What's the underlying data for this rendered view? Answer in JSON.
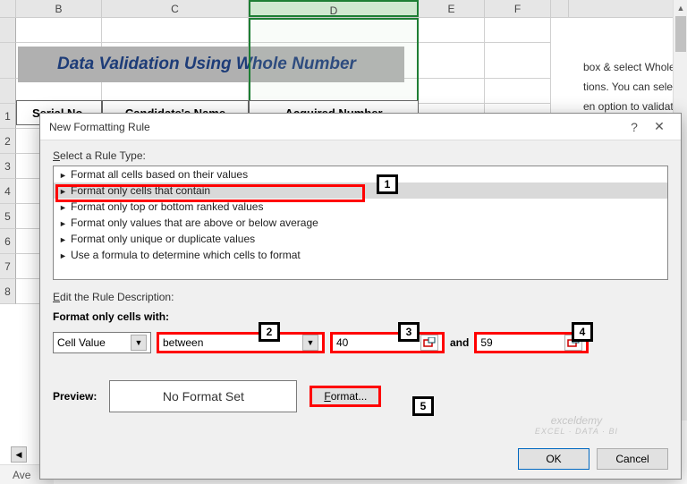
{
  "columns": [
    "",
    "B",
    "C",
    "D",
    "E",
    "F",
    ""
  ],
  "rows": [
    "",
    "",
    "",
    "1",
    "2",
    "3",
    "4",
    "5",
    "6",
    "7",
    "8"
  ],
  "banner_title": "Data Validation Using Whole Number",
  "table_headers": [
    "Serial No.",
    "Candidate's Name",
    "Acquired Number"
  ],
  "side_text": [
    "box & select Whole",
    "tions. You can selec",
    "en option to validate"
  ],
  "status_text": "Ave",
  "dialog": {
    "title": "New Formatting Rule",
    "help": "?",
    "close": "✕",
    "select_label": "Select a Rule Type:",
    "rule_types": [
      "Format all cells based on their values",
      "Format only cells that contain",
      "Format only top or bottom ranked values",
      "Format only values that are above or below average",
      "Format only unique or duplicate values",
      "Use a formula to determine which cells to format"
    ],
    "selected_type_index": 1,
    "edit_label": "Edit the Rule Description:",
    "format_only_label": "Format only cells with:",
    "cell_value": "Cell Value",
    "operator": "between",
    "val1": "40",
    "and": "and",
    "val2": "59",
    "preview_label": "Preview:",
    "preview_text": "No Format Set",
    "format_btn": "Format...",
    "ok": "OK",
    "cancel": "Cancel"
  },
  "callouts": {
    "1": "1",
    "2": "2",
    "3": "3",
    "4": "4",
    "5": "5"
  },
  "watermark": {
    "main": "exceldemy",
    "sub": "EXCEL · DATA · BI"
  }
}
